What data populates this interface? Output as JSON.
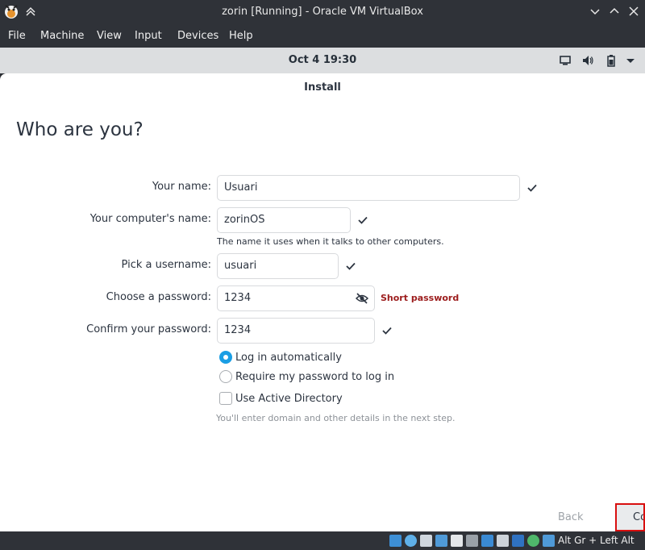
{
  "window": {
    "title": "zorin [Running] - Oracle VM VirtualBox",
    "icons": [
      "virtualbox-app-icon",
      "keep-above-icon",
      "minimize-icon",
      "maximize-icon",
      "close-icon"
    ]
  },
  "menubar": {
    "items": [
      "File",
      "Machine",
      "View",
      "Input",
      "Devices",
      "Help"
    ]
  },
  "guest_topbar": {
    "clock": "Oct 4  19:30",
    "icons": [
      "display-icon",
      "volume-icon",
      "battery-icon",
      "dropdown-arrow-icon"
    ]
  },
  "installer": {
    "header": "Install",
    "page_title": "Who are you?",
    "fields": {
      "name": {
        "label": "Your name:",
        "value": "Usuari"
      },
      "computer": {
        "label": "Your computer's name:",
        "value": "zorinOS",
        "hint": "The name it uses when it talks to other computers."
      },
      "username": {
        "label": "Pick a username:",
        "value": "usuari"
      },
      "password": {
        "label": "Choose a password:",
        "value": "1234",
        "warning": "Short password"
      },
      "confirm": {
        "label": "Confirm your password:",
        "value": "1234"
      }
    },
    "options": {
      "auto_login": {
        "label": "Log in automatically",
        "selected": true
      },
      "require_password": {
        "label": "Require my password to log in",
        "selected": false
      },
      "active_directory": {
        "label": "Use Active Directory",
        "checked": false,
        "hint": "You'll enter domain and other details in the next step."
      }
    },
    "buttons": {
      "back": "Back",
      "continue": "Continue"
    }
  },
  "statusbar": {
    "host_key": "Alt Gr + Left Alt"
  },
  "colors": {
    "accent": "#1a9ee4",
    "warning": "#9c1c1c",
    "highlight_border": "#d80f0f"
  }
}
